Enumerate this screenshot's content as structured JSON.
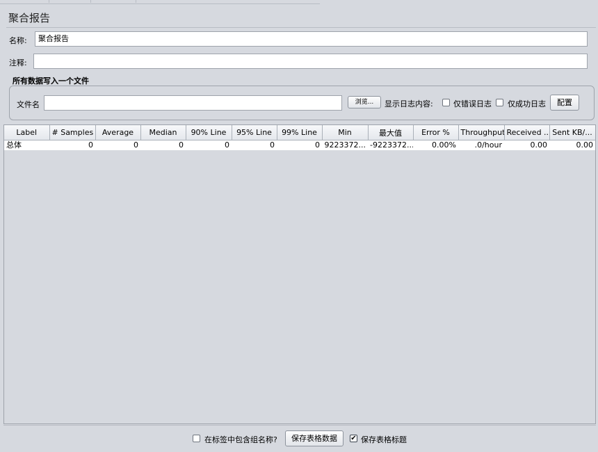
{
  "panel": {
    "title": "聚合报告"
  },
  "name_field": {
    "label": "名称:",
    "value": "聚合报告"
  },
  "comment_field": {
    "label": "注释:",
    "value": ""
  },
  "file_group": {
    "title": "所有数据写入一个文件",
    "filename_label": "文件名",
    "filename_value": "",
    "browse_label": "浏览...",
    "log_display_label": "显示日志内容:",
    "errors_only_label": "仅错误日志",
    "success_only_label": "仅成功日志",
    "configure_label": "配置"
  },
  "table": {
    "columns": [
      "Label",
      "# Samples",
      "Average",
      "Median",
      "90% Line",
      "95% Line",
      "99% Line",
      "Min",
      "最大值",
      "Error %",
      "Throughput",
      "Received ...",
      "Sent KB/..."
    ],
    "rows": [
      [
        "总体",
        "0",
        "0",
        "0",
        "0",
        "0",
        "0",
        "9223372...",
        "-9223372...",
        "0.00%",
        ".0/hour",
        "0.00",
        "0.00"
      ]
    ]
  },
  "footer": {
    "include_group_name_label": "在标签中包含组名称?",
    "save_table_data_label": "保存表格数据",
    "save_table_header_label": "保存表格标题",
    "save_table_header_checked": true
  }
}
